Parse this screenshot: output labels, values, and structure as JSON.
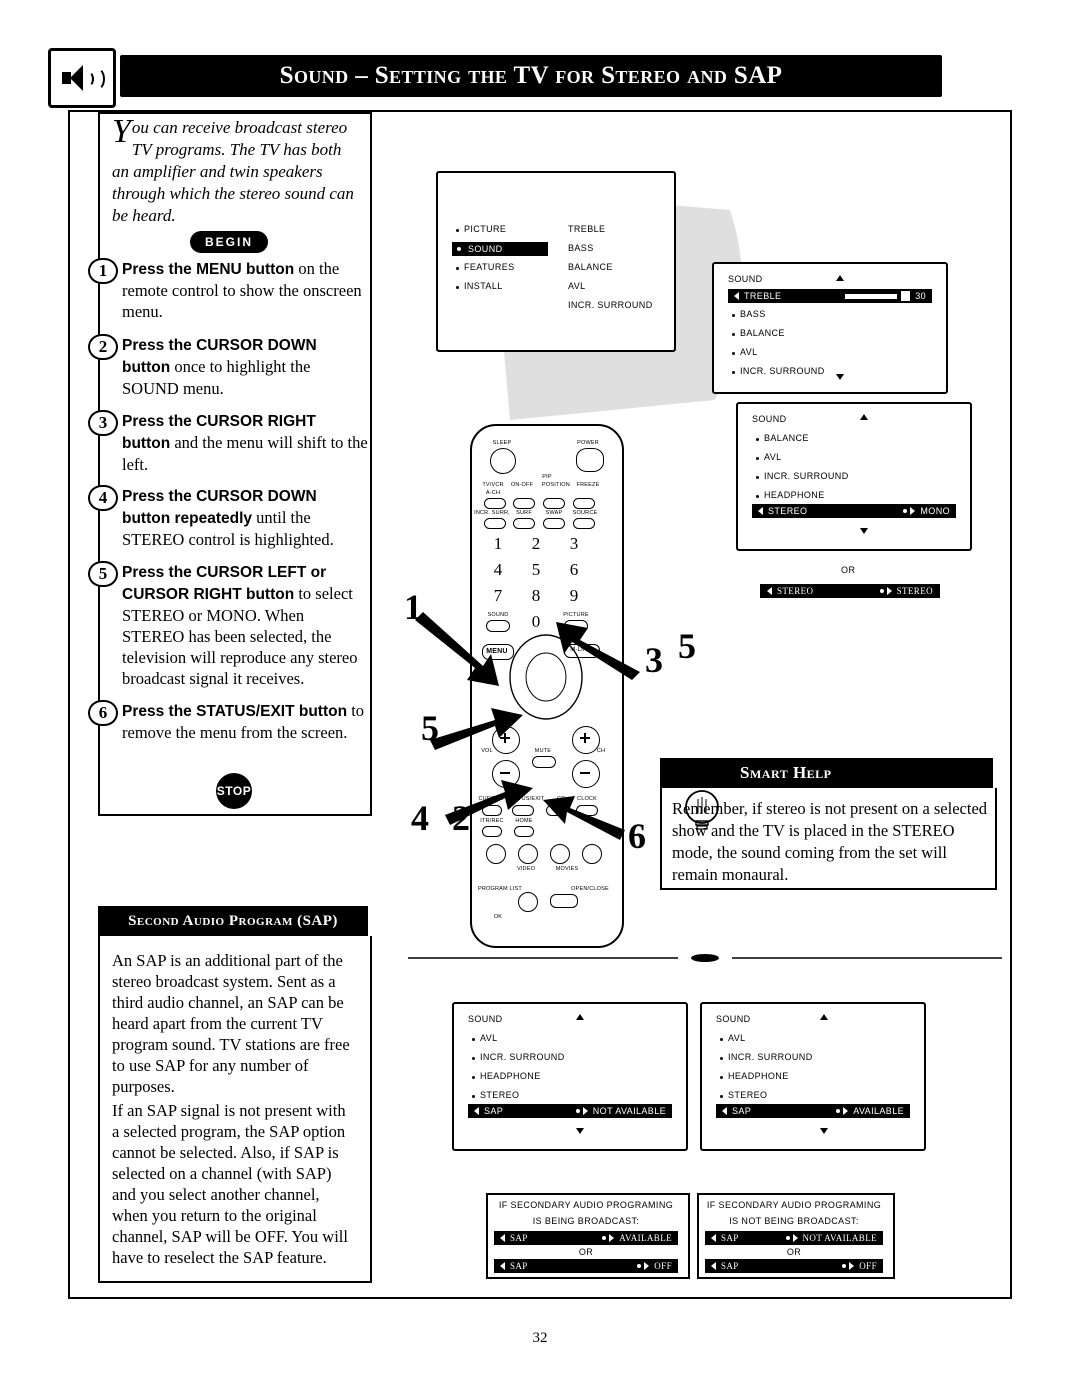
{
  "header": {
    "title": "Sound – Setting the TV for Stereo and SAP",
    "icon": "speaker-icon"
  },
  "intro": {
    "drop_cap": "Y",
    "text": "ou can receive broadcast stereo TV programs.  The TV has both an amplifier and twin speakers through which the stereo sound can be heard."
  },
  "begin_badge": "BEGIN",
  "stop_badge": "STOP",
  "steps": [
    {
      "num": "1",
      "bold": "Press the MENU button",
      "rest": " on the remote control to show the onscreen menu."
    },
    {
      "num": "2",
      "bold": "Press the CURSOR DOWN button",
      "rest": " once to highlight the SOUND menu."
    },
    {
      "num": "3",
      "bold": "Press the CURSOR RIGHT button",
      "rest": " and the menu will shift to the left."
    },
    {
      "num": "4",
      "bold": "Press the CURSOR DOWN button repeatedly",
      "rest": " until the STEREO control is highlighted."
    },
    {
      "num": "5",
      "bold": "Press the CURSOR LEFT or CURSOR RIGHT button",
      "rest": " to select STEREO or MONO.  When STEREO has been selected, the television will reproduce any stereo broadcast signal it receives."
    },
    {
      "num": "6",
      "bold": "Press the STATUS/EXIT button",
      "rest": " to remove the menu from the screen."
    }
  ],
  "sap": {
    "heading": "Second Audio Program (SAP)",
    "para1": "An SAP is an additional part of the stereo broadcast system.  Sent as a third audio channel, an SAP can be heard apart from the current TV program sound.  TV stations are free to use SAP for any number of purposes.",
    "para2": "If an SAP signal is not present with a selected program, the SAP option cannot be selected.  Also, if SAP is selected on a channel (with SAP) and you select another channel, when you return to the original channel, SAP will be OFF.  You will have to reselect the SAP feature."
  },
  "smart_help": {
    "title": "Smart Help",
    "icon": "lightbulb-icon",
    "text": "Remember, if stereo is not present on a selected show and the TV is placed in the STEREO mode, the sound coming from the set will remain monaural."
  },
  "osd_main": {
    "left_col": [
      "PICTURE",
      "SOUND",
      "FEATURES",
      "INSTALL"
    ],
    "right_col": [
      "TREBLE",
      "BASS",
      "BALANCE",
      "AVL",
      "INCR. SURROUND"
    ],
    "highlighted": "SOUND"
  },
  "osd_treble": {
    "title": "SOUND",
    "highlight_label": "TREBLE",
    "highlight_value": "30",
    "items": [
      "BASS",
      "BALANCE",
      "AVL",
      "INCR. SURROUND"
    ]
  },
  "osd_stereo": {
    "title": "SOUND",
    "items": [
      "BALANCE",
      "AVL",
      "INCR. SURROUND",
      "HEADPHONE"
    ],
    "highlight_label": "STEREO",
    "highlight_value": "MONO"
  },
  "osd_or": {
    "or_label": "OR",
    "bar_label": "STEREO",
    "bar_value": "STEREO"
  },
  "osd_sap_left": {
    "title": "SOUND",
    "items": [
      "AVL",
      "INCR. SURROUND",
      "HEADPHONE",
      "STEREO"
    ],
    "highlight_label": "SAP",
    "highlight_value": "NOT AVAILABLE"
  },
  "osd_sap_right": {
    "title": "SOUND",
    "items": [
      "AVL",
      "INCR. SURROUND",
      "HEADPHONE",
      "STEREO"
    ],
    "highlight_label": "SAP",
    "highlight_value": "AVAILABLE"
  },
  "caption_left": {
    "line1": "IF SECONDARY AUDIO PROGRAMING",
    "line2": "IS BEING BROADCAST:",
    "bar1_label": "SAP",
    "bar1_value": "AVAILABLE",
    "or": "OR",
    "bar2_label": "SAP",
    "bar2_value": "OFF"
  },
  "caption_right": {
    "line1": "IF SECONDARY AUDIO PROGRAMING",
    "line2": "IS NOT BEING BROADCAST:",
    "bar1_label": "SAP",
    "bar1_value": "NOT AVAILABLE",
    "or": "OR",
    "bar2_label": "SAP",
    "bar2_value": "OFF"
  },
  "remote": {
    "labels": {
      "sleep": "SLEEP",
      "power": "POWER",
      "pip": "PIP",
      "tv_vcr": "TV/VCR",
      "on_off": "ON-OFF",
      "position": "POSITION",
      "freeze": "FREEZE",
      "a_ch": "A-CH",
      "incr_surr": "INCR. SURR.",
      "surf": "SURF",
      "swap": "SWAP",
      "source": "SOURCE",
      "sound": "SOUND",
      "picture": "PICTURE",
      "menu": "MENU",
      "m_link": "M-LINK",
      "vol": "VOL",
      "mute": "MUTE",
      "ch": "CH",
      "cursor": "CURSOR",
      "status_exit": "STATUS/EXIT",
      "cc": "CC",
      "clock": "CLOCK",
      "itr_rec": "ITR/REC",
      "home": "HOME",
      "video": "VIDEO",
      "movies": "MOVIES",
      "program_list": "PROGRAM LIST",
      "open_close": "OPEN/CLOSE",
      "ok": "OK"
    },
    "keypad": [
      "1",
      "2",
      "3",
      "4",
      "5",
      "6",
      "7",
      "8",
      "9",
      "0"
    ]
  },
  "callouts": [
    "1",
    "2",
    "3",
    "4",
    "5",
    "6"
  ],
  "page_number": "32"
}
